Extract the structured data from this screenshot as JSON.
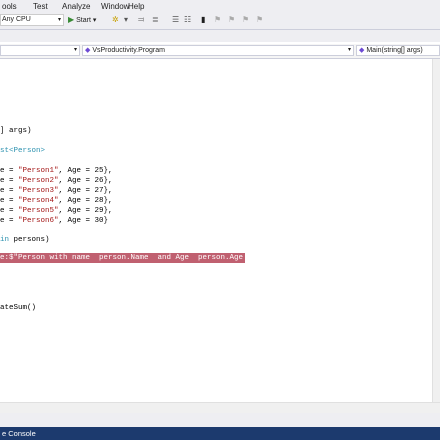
{
  "menu": [
    "ools",
    "Test",
    "Analyze",
    "Window",
    "Help"
  ],
  "toolbar": {
    "platform": "Any CPU",
    "start_label": "Start",
    "dropdown_arrow": "▾",
    "play_glyph": "▶"
  },
  "navbar": {
    "class_path": "VsProductivity.Program",
    "member": "Main(string[] args)"
  },
  "code": {
    "l1": "] args)",
    "l2_kw": "st",
    "l2_type": "<Person>",
    "l3_pre": "e = ",
    "l3_str": "\"Person1\"",
    "l3_post": ", Age = 25},",
    "l4_pre": "e = ",
    "l4_str": "\"Person2\"",
    "l4_post": ", Age = 26},",
    "l5_pre": "e = ",
    "l5_str": "\"Person3\"",
    "l5_post": ", Age = 27},",
    "l6_pre": "e = ",
    "l6_str": "\"Person4\"",
    "l6_post": ", Age = 28},",
    "l7_pre": "e = ",
    "l7_str": "\"Person5\"",
    "l7_post": ", Age = 29},",
    "l8_pre": "e = ",
    "l8_str": "\"Person6\"",
    "l8_post": ", Age = 30}",
    "l9_kw": "in",
    "l9_post": " persons)",
    "l10": "e:$\"Person with name  person.Name  and Age  person.Age \";",
    "l11": "ateSum()"
  },
  "status": {
    "label": "e Console"
  }
}
